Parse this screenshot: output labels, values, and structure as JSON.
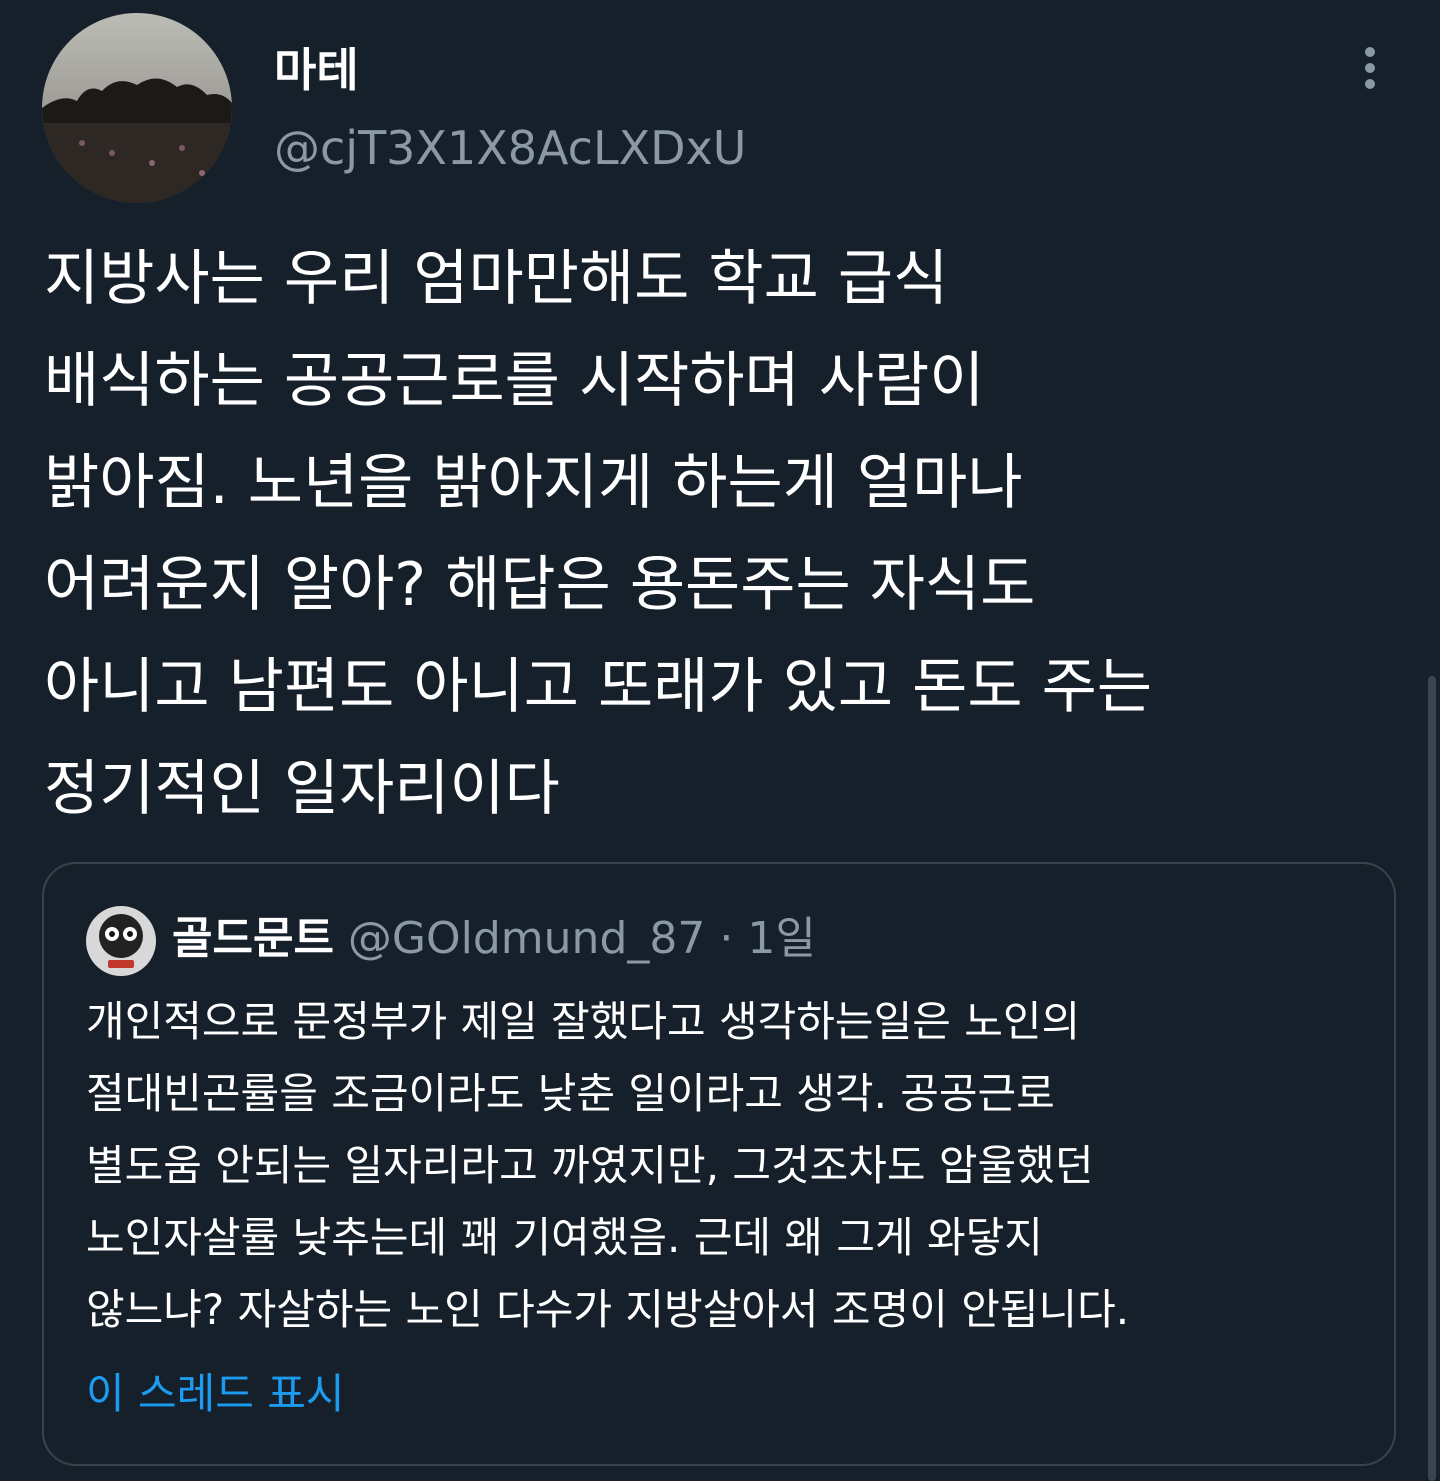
{
  "tweet": {
    "display_name": "마테",
    "handle": "@cjT3X1X8AcLXDxU",
    "text": "지방사는 우리 엄마만해도 학교 급식\n배식하는 공공근로를 시작하며 사람이\n밝아짐. 노년을 밝아지게 하는게 얼마나\n어려운지 알아? 해답은 용돈주는 자식도\n아니고 남편도 아니고 또래가 있고 돈도 주는\n정기적인 일자리이다"
  },
  "quoted_tweet": {
    "display_name": "골드문트",
    "handle": "@GOldmund_87",
    "separator": " · ",
    "time": "1일",
    "text": "개인적으로 문정부가 제일 잘했다고 생각하는일은 노인의\n절대빈곤률을 조금이라도 낮춘 일이라고 생각. 공공근로\n별도움 안되는 일자리라고 까였지만, 그것조차도 암울했던\n노인자살률 낮추는데 꽤 기여했음. 근데 왜 그게 와닿지\n않느냐? 자살하는 노인 다수가 지방살아서 조명이 안됩니다.",
    "show_thread": "이 스레드 표시"
  },
  "icons": {
    "more": "more-vertical-icon"
  },
  "colors": {
    "background": "#15202b",
    "text_primary": "#ffffff",
    "text_secondary": "#8b98a5",
    "link": "#1d9bf0",
    "border": "#38444d"
  }
}
